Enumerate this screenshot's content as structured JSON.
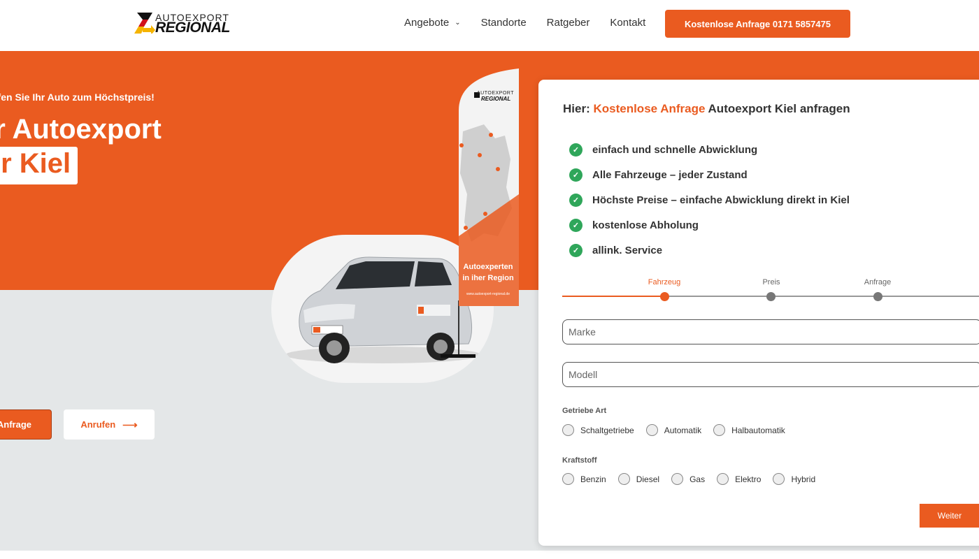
{
  "header": {
    "logo_line1": "AUTOEXPORT",
    "logo_line2": "REGIONAL",
    "nav": [
      {
        "label": "Angebote",
        "has_dropdown": true
      },
      {
        "label": "Standorte"
      },
      {
        "label": "Ratgeber"
      },
      {
        "label": "Kontakt"
      }
    ],
    "cta_label": "Kostenlose Anfrage 0171 5857475"
  },
  "hero": {
    "subtitle": "ufen Sie Ihr Auto zum Höchstpreis!",
    "title_line1": "er Autoexport",
    "title_line2": "ır Kiel",
    "btn_anfrage": "Anfrage",
    "btn_anrufen": "Anrufen",
    "flag_text_1": "Autoexperten",
    "flag_text_2": "in iher Region",
    "flag_url": "www.autoexport-regional.de",
    "flag_brand_1": "AUTOEXPORT",
    "flag_brand_2": "REGIONAL"
  },
  "form": {
    "title_prefix": "Hier: ",
    "title_highlight": "Kostenlose Anfrage",
    "title_suffix": " Autoexport Kiel anfragen",
    "benefits": [
      "einfach und schnelle Abwicklung",
      "Alle Fahrzeuge – jeder Zustand",
      "Höchste Preise – einfache Abwicklung direkt in Kiel",
      "kostenlose Abholung",
      "allink. Service"
    ],
    "steps": [
      {
        "label": "Fahrzeug",
        "active": true
      },
      {
        "label": "Preis",
        "active": false
      },
      {
        "label": "Anfrage",
        "active": false
      }
    ],
    "marke_placeholder": "Marke",
    "modell_placeholder": "Modell",
    "getriebe_label": "Getriebe Art",
    "getriebe_options": [
      "Schaltgetriebe",
      "Automatik",
      "Halbautomatik"
    ],
    "kraftstoff_label": "Kraftstoff",
    "kraftstoff_options": [
      "Benzin",
      "Diesel",
      "Gas",
      "Elektro",
      "Hybrid"
    ],
    "next_label": "Weiter"
  },
  "colors": {
    "accent": "#ea5b20",
    "check": "#2fa65a",
    "hero_grey": "#e4e7e8"
  }
}
